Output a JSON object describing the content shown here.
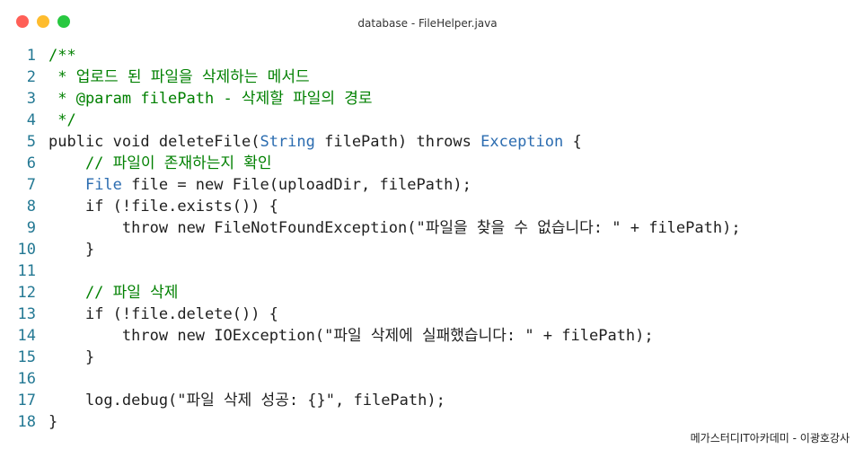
{
  "window": {
    "title": "database - FileHelper.java",
    "controls": [
      "close",
      "minimize",
      "maximize"
    ]
  },
  "colors": {
    "comment": "#008000",
    "keyword": "#0000ff",
    "type": "#2b6cb0",
    "string": "#a31515",
    "plain": "#1f1f1f",
    "line_number": "#237893"
  },
  "code": {
    "lines": [
      {
        "n": "1",
        "tokens": [
          {
            "t": "/**",
            "k": "comment"
          }
        ]
      },
      {
        "n": "2",
        "tokens": [
          {
            "t": " * 업로드 된 파일을 삭제하는 메서드",
            "k": "comment"
          }
        ]
      },
      {
        "n": "3",
        "tokens": [
          {
            "t": " * @param filePath - 삭제할 파일의 경로",
            "k": "comment"
          }
        ]
      },
      {
        "n": "4",
        "tokens": [
          {
            "t": " */",
            "k": "comment"
          }
        ]
      },
      {
        "n": "5",
        "tokens": [
          {
            "t": "public",
            "k": "keyword"
          },
          {
            "t": " ",
            "k": "plain"
          },
          {
            "t": "void",
            "k": "keyword"
          },
          {
            "t": " deleteFile(",
            "k": "plain"
          },
          {
            "t": "String",
            "k": "type"
          },
          {
            "t": " filePath) ",
            "k": "plain"
          },
          {
            "t": "throws",
            "k": "keyword"
          },
          {
            "t": " ",
            "k": "plain"
          },
          {
            "t": "Exception",
            "k": "type"
          },
          {
            "t": " {",
            "k": "plain"
          }
        ]
      },
      {
        "n": "6",
        "tokens": [
          {
            "t": "    // 파일이 존재하는지 확인",
            "k": "comment"
          }
        ]
      },
      {
        "n": "7",
        "tokens": [
          {
            "t": "    ",
            "k": "plain"
          },
          {
            "t": "File",
            "k": "type"
          },
          {
            "t": " file = ",
            "k": "plain"
          },
          {
            "t": "new",
            "k": "keyword"
          },
          {
            "t": " File(uploadDir, filePath);",
            "k": "plain"
          }
        ]
      },
      {
        "n": "8",
        "tokens": [
          {
            "t": "    ",
            "k": "plain"
          },
          {
            "t": "if",
            "k": "keyword"
          },
          {
            "t": " (!file.exists()) {",
            "k": "plain"
          }
        ]
      },
      {
        "n": "9",
        "tokens": [
          {
            "t": "        ",
            "k": "plain"
          },
          {
            "t": "throw",
            "k": "keyword"
          },
          {
            "t": " ",
            "k": "plain"
          },
          {
            "t": "new",
            "k": "keyword"
          },
          {
            "t": " FileNotFoundException(",
            "k": "plain"
          },
          {
            "t": "\"파일을 찾을 수 없습니다: \"",
            "k": "string"
          },
          {
            "t": " + filePath);",
            "k": "plain"
          }
        ]
      },
      {
        "n": "10",
        "tokens": [
          {
            "t": "    }",
            "k": "plain"
          }
        ]
      },
      {
        "n": "11",
        "tokens": []
      },
      {
        "n": "12",
        "tokens": [
          {
            "t": "    // 파일 삭제",
            "k": "comment"
          }
        ]
      },
      {
        "n": "13",
        "tokens": [
          {
            "t": "    ",
            "k": "plain"
          },
          {
            "t": "if",
            "k": "keyword"
          },
          {
            "t": " (!file.delete()) {",
            "k": "plain"
          }
        ]
      },
      {
        "n": "14",
        "tokens": [
          {
            "t": "        ",
            "k": "plain"
          },
          {
            "t": "throw",
            "k": "keyword"
          },
          {
            "t": " ",
            "k": "plain"
          },
          {
            "t": "new",
            "k": "keyword"
          },
          {
            "t": " IOException(",
            "k": "plain"
          },
          {
            "t": "\"파일 삭제에 실패했습니다: \"",
            "k": "string"
          },
          {
            "t": " + filePath);",
            "k": "plain"
          }
        ]
      },
      {
        "n": "15",
        "tokens": [
          {
            "t": "    }",
            "k": "plain"
          }
        ]
      },
      {
        "n": "16",
        "tokens": []
      },
      {
        "n": "17",
        "tokens": [
          {
            "t": "    log.debug(",
            "k": "plain"
          },
          {
            "t": "\"파일 삭제 성공: {}\"",
            "k": "string"
          },
          {
            "t": ", filePath);",
            "k": "plain"
          }
        ]
      },
      {
        "n": "18",
        "tokens": [
          {
            "t": "}",
            "k": "plain"
          }
        ]
      }
    ]
  },
  "watermark": "메가스터디IT아카데미 - 이광호강사"
}
